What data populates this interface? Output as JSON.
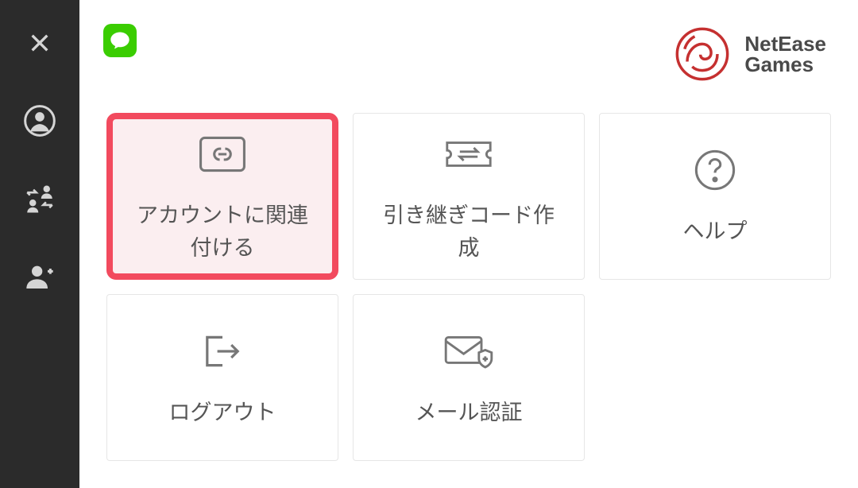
{
  "sidebar": {
    "items": [
      {
        "name": "close",
        "icon": "close-icon"
      },
      {
        "name": "profile",
        "icon": "profile-icon"
      },
      {
        "name": "transfer",
        "icon": "swap-people-icon"
      },
      {
        "name": "add-user",
        "icon": "add-user-icon"
      }
    ]
  },
  "brand": {
    "name_line1": "NetEase",
    "name_line2": "Games"
  },
  "cards": {
    "link_account": {
      "label": "アカウントに関連\n付ける",
      "highlighted": true
    },
    "transfer_code": {
      "label": "引き継ぎコード作\n成",
      "highlighted": false
    },
    "help": {
      "label": "ヘルプ",
      "highlighted": false
    },
    "logout": {
      "label": "ログアウト",
      "highlighted": false
    },
    "mail_auth": {
      "label": "メール認証",
      "highlighted": false
    }
  }
}
